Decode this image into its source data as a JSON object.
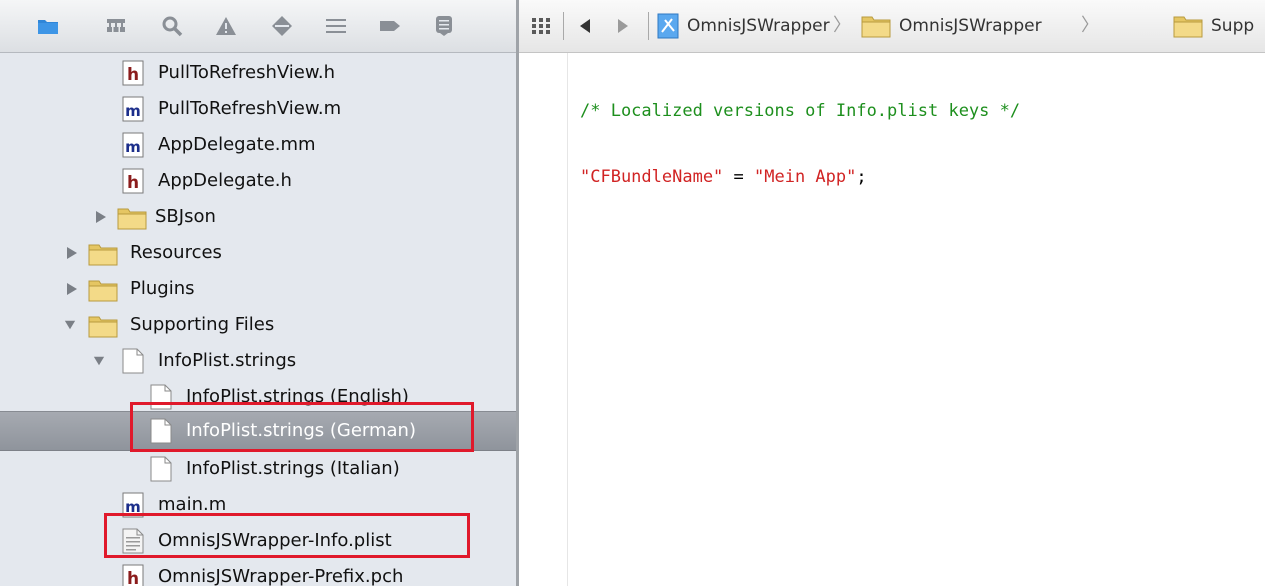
{
  "navigator": {
    "toolbar_icons": [
      "folder-icon",
      "hierarchy-icon",
      "search-icon",
      "warning-icon",
      "breakpoint-icon",
      "list-icon",
      "tag-icon",
      "log-icon"
    ],
    "tree": [
      {
        "label": "PullToRefreshView.h",
        "icon": "header-file-icon",
        "badge": "h"
      },
      {
        "label": "PullToRefreshView.m",
        "icon": "implementation-file-icon",
        "badge": "m"
      },
      {
        "label": "AppDelegate.mm",
        "icon": "implementation-file-icon",
        "badge": "m"
      },
      {
        "label": "AppDelegate.h",
        "icon": "header-file-icon",
        "badge": "h"
      },
      {
        "label": "SBJson",
        "icon": "folder-icon",
        "expanded": false
      },
      {
        "label": "Resources",
        "icon": "folder-icon",
        "expanded": false
      },
      {
        "label": "Plugins",
        "icon": "folder-icon",
        "expanded": false
      },
      {
        "label": "Supporting Files",
        "icon": "folder-icon",
        "expanded": true
      },
      {
        "label": "InfoPlist.strings",
        "icon": "strings-file-icon",
        "expanded": true
      },
      {
        "label": "InfoPlist.strings (English)",
        "icon": "strings-file-icon"
      },
      {
        "label": "InfoPlist.strings (German)",
        "icon": "strings-file-icon",
        "selected": true
      },
      {
        "label": "InfoPlist.strings (Italian)",
        "icon": "strings-file-icon"
      },
      {
        "label": "main.m",
        "icon": "implementation-file-icon",
        "badge": "m"
      },
      {
        "label": "OmnisJSWrapper-Info.plist",
        "icon": "plist-file-icon"
      },
      {
        "label": "OmnisJSWrapper-Prefix.pch",
        "icon": "header-file-icon",
        "badge": "h"
      }
    ]
  },
  "jump_bar": {
    "crumbs": [
      "OmnisJSWrapper",
      "OmnisJSWrapper",
      "Supp"
    ]
  },
  "editor": {
    "lines": [
      [
        {
          "type": "comment",
          "text": "/* Localized versions of Info.plist keys */"
        }
      ],
      [
        {
          "type": "string",
          "text": "\"CFBundleName\""
        },
        {
          "type": "plain",
          "text": " = "
        },
        {
          "type": "string",
          "text": "\"Mein App\""
        },
        {
          "type": "plain",
          "text": ";"
        }
      ]
    ]
  },
  "colors": {
    "highlight": "#e0192b",
    "comment": "#1d8f1d",
    "string": "#d12424",
    "folder": "#f0d47a"
  }
}
